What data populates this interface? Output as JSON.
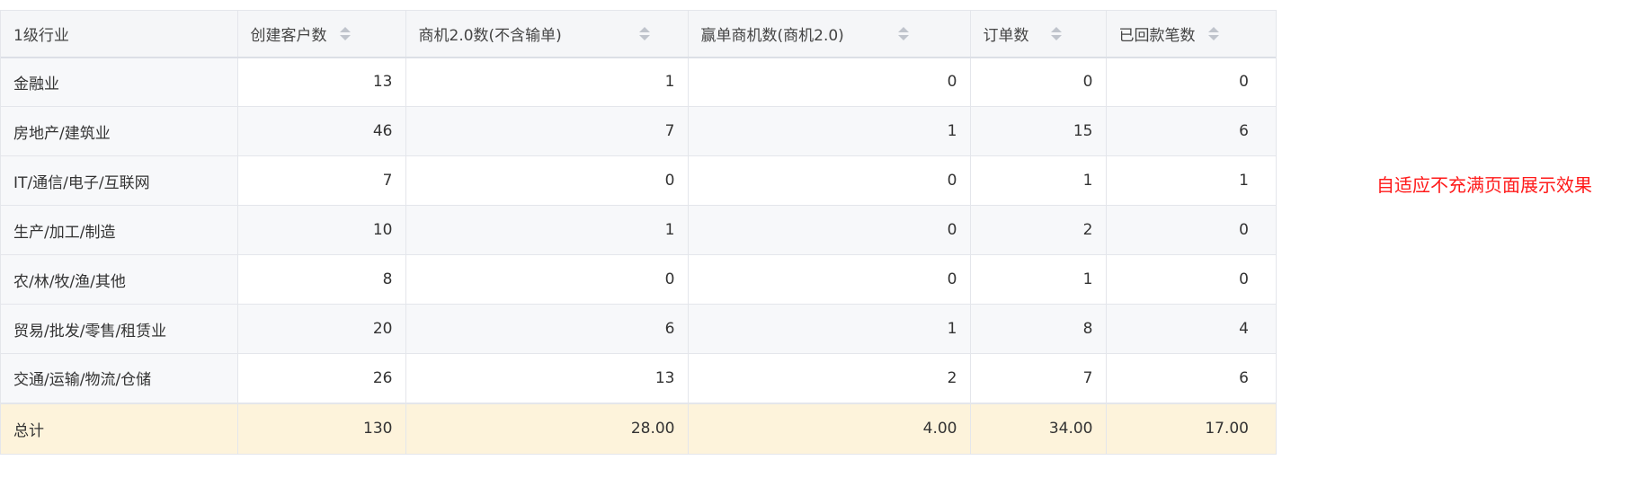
{
  "table": {
    "columns": [
      "1级行业",
      "创建客户数",
      "商机2.0数(不含输单)",
      "赢单商机数(商机2.0)",
      "订单数",
      "已回款笔数"
    ],
    "rows": [
      [
        "金融业",
        "13",
        "1",
        "0",
        "0",
        "0"
      ],
      [
        "房地产/建筑业",
        "46",
        "7",
        "1",
        "15",
        "6"
      ],
      [
        "IT/通信/电子/互联网",
        "7",
        "0",
        "0",
        "1",
        "1"
      ],
      [
        "生产/加工/制造",
        "10",
        "1",
        "0",
        "2",
        "0"
      ],
      [
        "农/林/牧/渔/其他",
        "8",
        "0",
        "0",
        "1",
        "0"
      ],
      [
        "贸易/批发/零售/租赁业",
        "20",
        "6",
        "1",
        "8",
        "4"
      ],
      [
        "交通/运输/物流/仓储",
        "26",
        "13",
        "2",
        "7",
        "6"
      ]
    ],
    "total": [
      "总计",
      "130",
      "28.00",
      "4.00",
      "34.00",
      "17.00"
    ]
  },
  "note": "自适应不充满页面展示效果",
  "colors": {
    "header_bg": "#f5f6f8",
    "total_bg": "#fdf3db",
    "note": "#ff1a1a"
  },
  "icons": {
    "sort": "sort-caret-icon"
  }
}
